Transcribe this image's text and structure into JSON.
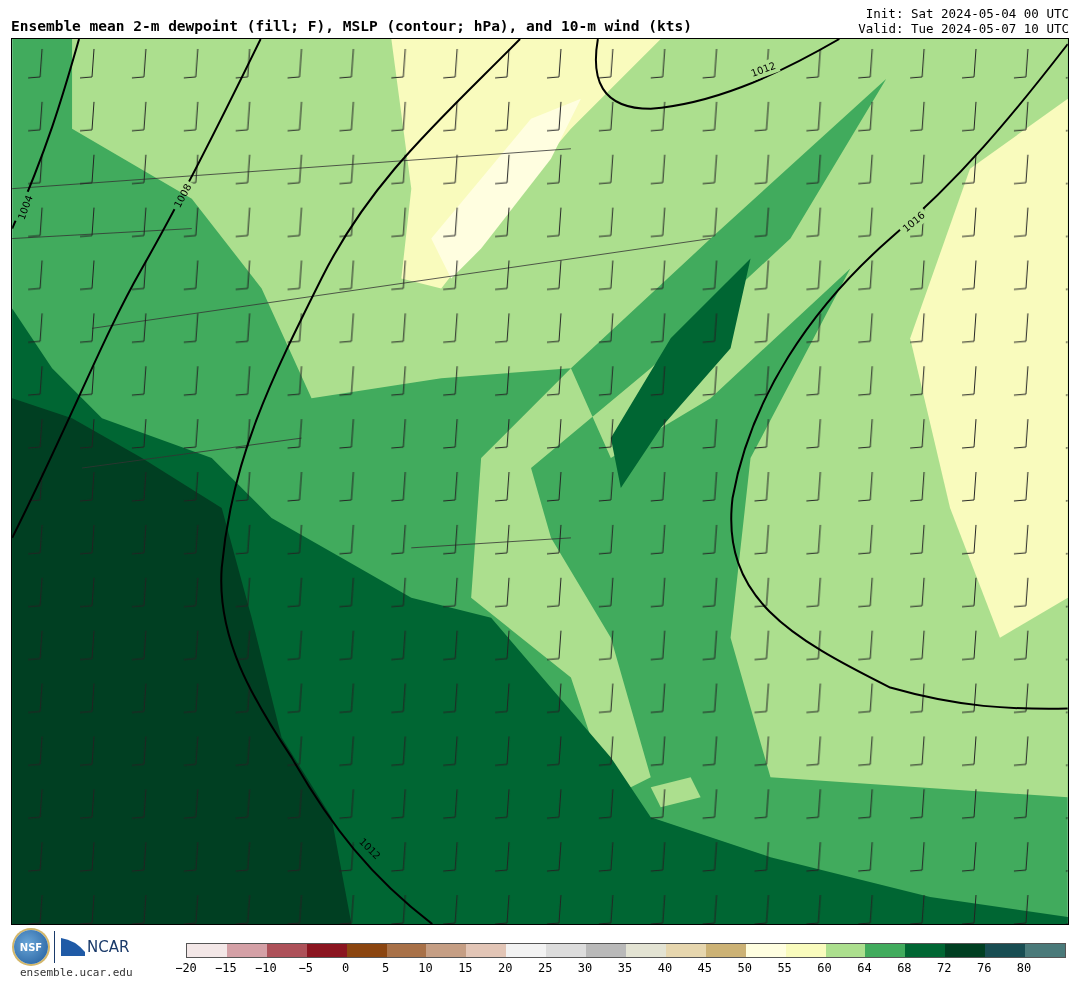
{
  "title": "Ensemble mean 2-m dewpoint (fill; F), MSLP (contour; hPa), and 10-m wind (kts)",
  "init": "Init: Sat 2024-05-04 00 UTC",
  "valid": "Valid: Tue 2024-05-07 10 UTC",
  "map": {
    "isobars": [
      {
        "label": "1004"
      },
      {
        "label": "1008"
      },
      {
        "label": "1012"
      },
      {
        "label": "1012"
      },
      {
        "label": "1016"
      }
    ]
  },
  "logos": {
    "nsf": "NSF",
    "ncar": "NCAR",
    "site": "ensemble.ucar.edu"
  },
  "colorbar": {
    "segments": [
      {
        "color": "#f3e7e7"
      },
      {
        "color": "#d4a0a6"
      },
      {
        "color": "#ad5159"
      },
      {
        "color": "#8b1520"
      },
      {
        "color": "#8b4510"
      },
      {
        "color": "#a87148"
      },
      {
        "color": "#c59e84"
      },
      {
        "color": "#e2c5b6"
      },
      {
        "color": "#f2f2f2"
      },
      {
        "color": "#dcdcdc"
      },
      {
        "color": "#b9b9b9"
      },
      {
        "color": "#e3e3d3"
      },
      {
        "color": "#e6d6ae"
      },
      {
        "color": "#ccb275"
      },
      {
        "color": "#fffee0"
      },
      {
        "color": "#f9fbbd"
      },
      {
        "color": "#acdf8e"
      },
      {
        "color": "#41ab5d"
      },
      {
        "color": "#006633"
      },
      {
        "color": "#003f22"
      },
      {
        "color": "#184d52"
      },
      {
        "color": "#4a7a7a"
      }
    ],
    "ticks": [
      "−20",
      "−15",
      "−10",
      "−5",
      "0",
      "5",
      "10",
      "15",
      "20",
      "25",
      "30",
      "35",
      "40",
      "45",
      "50",
      "55",
      "60",
      "64",
      "68",
      "72",
      "76",
      "80"
    ]
  }
}
